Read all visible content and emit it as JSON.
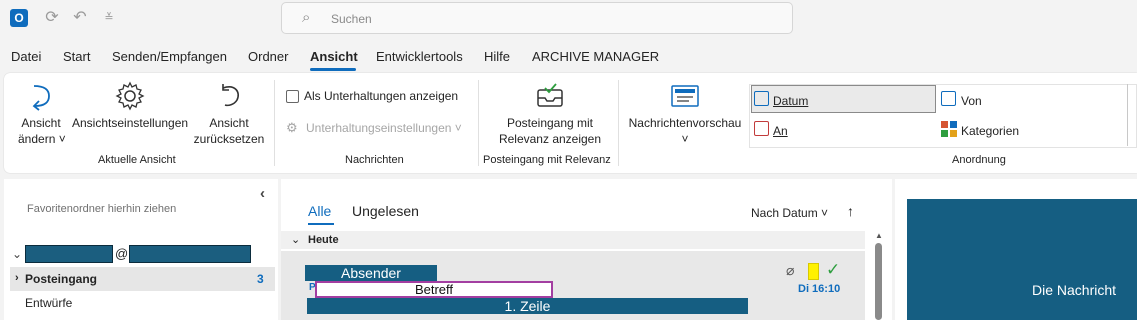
{
  "titlebar": {
    "app_icon_letter": "O",
    "search_placeholder": "Suchen"
  },
  "menu": {
    "tabs": [
      "Datei",
      "Start",
      "Senden/Empfangen",
      "Ordner",
      "Ansicht",
      "Entwicklertools",
      "Hilfe",
      "ARCHIVE MANAGER"
    ],
    "active": "Ansicht"
  },
  "ribbon": {
    "aktuelle_ansicht": {
      "group_label": "Aktuelle Ansicht",
      "ansicht_aendern": [
        "Ansicht",
        "ändern ˅"
      ],
      "ansichtseinstellungen": "Ansichtseinstellungen",
      "ansicht_zuruecksetzen": [
        "Ansicht",
        "zurücksetzen"
      ]
    },
    "nachrichten": {
      "group_label": "Nachrichten",
      "unterhaltungen_anzeigen": "Als Unterhaltungen anzeigen",
      "unterhaltungseinstellungen": "Unterhaltungseinstellungen ˅"
    },
    "posteingang_relevanz": {
      "group_label": "Posteingang mit Relevanz",
      "button": [
        "Posteingang mit",
        "Relevanz anzeigen"
      ]
    },
    "nachrichtenvorschau": {
      "label": "Nachrichtenvorschau",
      "chevron": "˅"
    },
    "anordnung": {
      "group_label": "Anordnung",
      "items": [
        "Datum",
        "Von",
        "An",
        "Kategorien"
      ],
      "selected": "Datum"
    }
  },
  "folder_pane": {
    "favorites_hint": "Favoritenordner hierhin ziehen",
    "collapse_chevron": "‹",
    "account_at": "@",
    "folders": [
      {
        "name": "Posteingang",
        "count": "3"
      },
      {
        "name": "Entwürfe",
        "count": ""
      }
    ]
  },
  "message_list": {
    "tabs": [
      "Alle",
      "Ungelesen"
    ],
    "active_tab": "Alle",
    "sort_label": "Nach Datum",
    "sort_dir_icon": "↑",
    "group_header": "Heute",
    "item": {
      "sender": "Absender",
      "subject": "Betreff",
      "preview": "1. Zeile",
      "time": "Di 16:10",
      "marker": "P"
    }
  },
  "reading_pane": {
    "text": "Die Nachricht"
  },
  "colors": {
    "accent": "#0f6cbd",
    "redact_block": "#155e82",
    "flag_yellow": "#fff100",
    "check_green": "#2e9e3f",
    "betreff_border": "#a33ea1"
  }
}
